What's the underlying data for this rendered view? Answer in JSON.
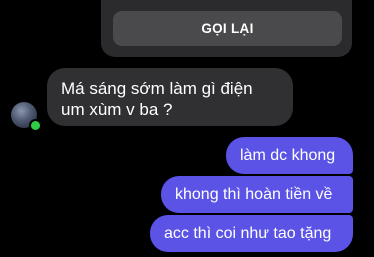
{
  "call_card": {
    "callback_label": "GỌI LẠI"
  },
  "messages": {
    "incoming": [
      {
        "text": "Má sáng sớm làm gì điện um xùm v ba ?"
      }
    ],
    "outgoing": [
      {
        "text": "làm dc khong"
      },
      {
        "text": "khong thì hoàn tiền về"
      },
      {
        "text": "acc thì coi như tao tặng"
      }
    ]
  },
  "colors": {
    "background": "#000000",
    "incoming_bubble": "#303033",
    "outgoing_bubble": "#5a53e6",
    "online_status": "#31cc46"
  }
}
